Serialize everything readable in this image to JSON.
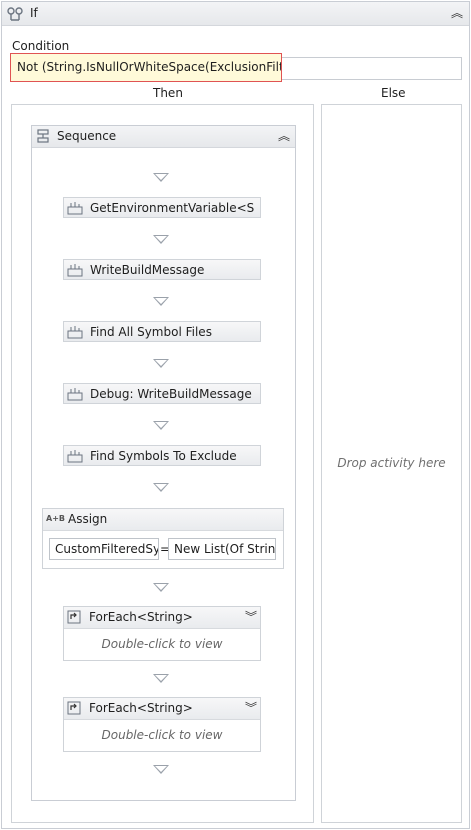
{
  "if_activity": {
    "title": "If",
    "collapse_icon": "chevron-double-up-icon"
  },
  "condition": {
    "label": "Condition",
    "expression": "Not (String.IsNullOrWhiteSpace(ExclusionFilter))"
  },
  "branches": {
    "then_label": "Then",
    "else_label": "Else",
    "else_placeholder": "Drop activity here"
  },
  "sequence": {
    "title": "Sequence",
    "activities": [
      {
        "label": "GetEnvironmentVariable<S"
      },
      {
        "label": "WriteBuildMessage"
      },
      {
        "label": "Find All Symbol Files"
      },
      {
        "label": "Debug: WriteBuildMessage"
      },
      {
        "label": "Find Symbols To Exclude"
      }
    ],
    "assign": {
      "icon_text": "A+B",
      "title": "Assign",
      "to": "CustomFilteredSyr",
      "operator": "=",
      "value": "New List(Of String)"
    },
    "foreach": [
      {
        "title": "ForEach<String>",
        "body": "Double-click to view"
      },
      {
        "title": "ForEach<String>",
        "body": "Double-click to view"
      }
    ]
  }
}
